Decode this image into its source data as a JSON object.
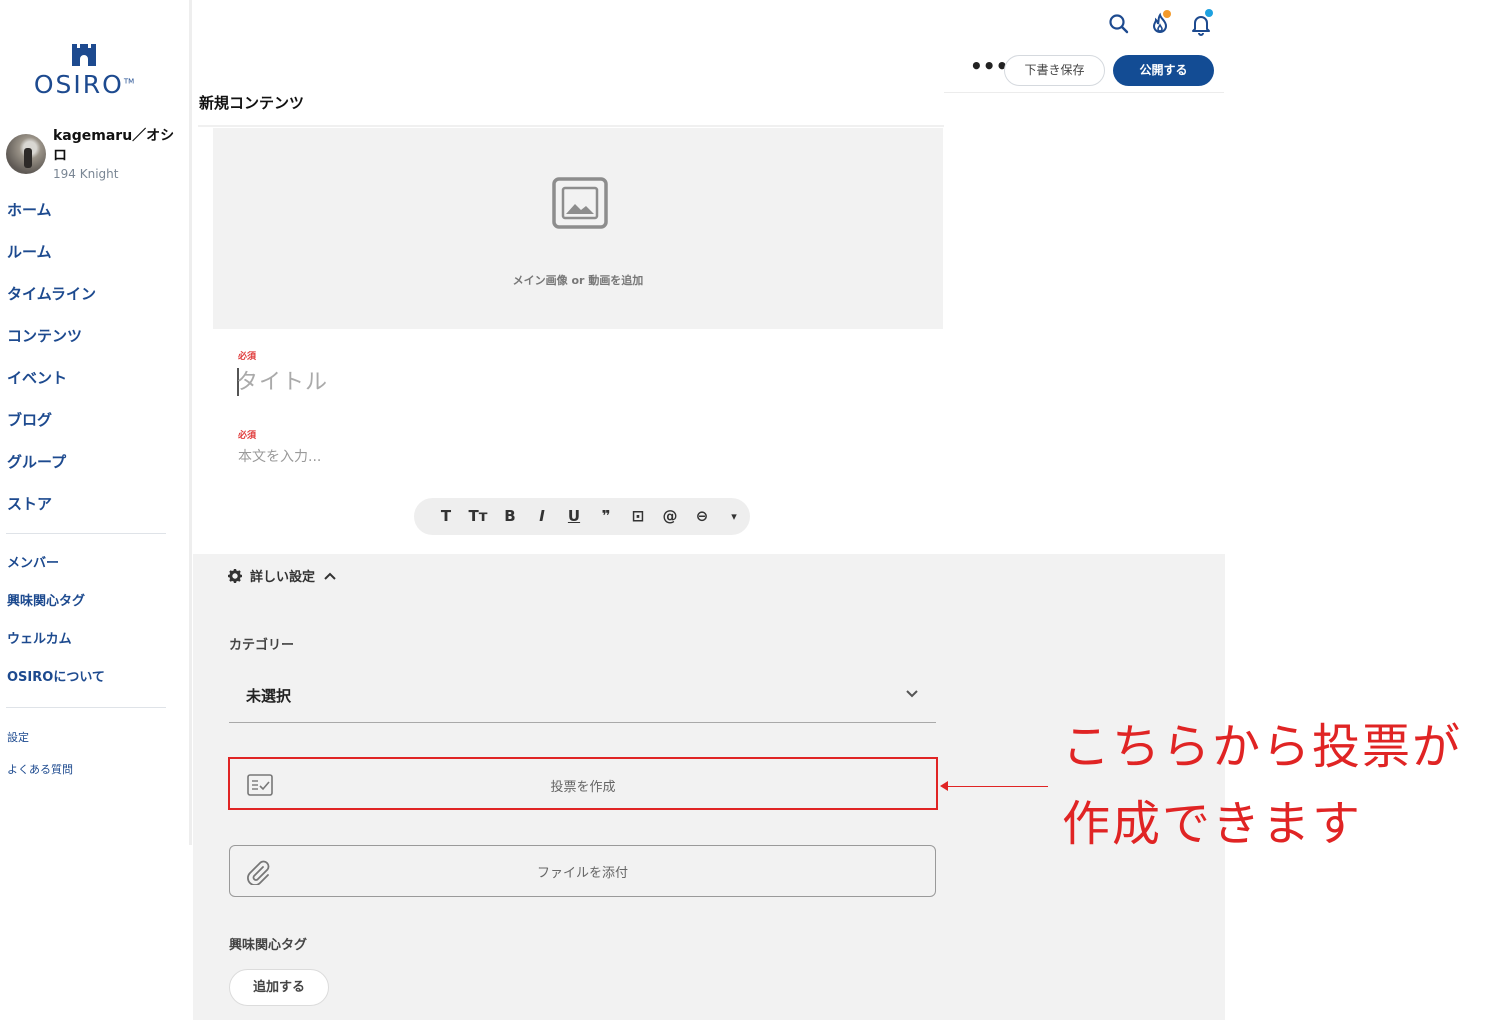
{
  "brand": {
    "name": "OSIRO",
    "tm": "TM"
  },
  "user": {
    "name": "kagemaru／オシロ",
    "points": "194 Knight"
  },
  "nav": {
    "items": [
      "ホーム",
      "ルーム",
      "タイムライン",
      "コンテンツ",
      "イベント",
      "ブログ",
      "グループ",
      "ストア"
    ]
  },
  "nav_secondary": {
    "items": [
      "メンバー",
      "興味関心タグ",
      "ウェルカム",
      "OSIROについて"
    ]
  },
  "nav_footer": {
    "items": [
      "設定",
      "よくある質問"
    ]
  },
  "header": {
    "more": "•••",
    "save_draft": "下書き保存",
    "publish": "公開する"
  },
  "page": {
    "title": "新規コンテンツ"
  },
  "media": {
    "label": "メイン画像 or 動画を追加"
  },
  "form": {
    "required_badge": "必須",
    "title_placeholder": "タイトル",
    "body_placeholder": "本文を入力..."
  },
  "toolbar": {
    "buttons": [
      "T",
      "Tт",
      "B",
      "I",
      "U",
      "❞",
      "⊡",
      "@",
      "⊖",
      "▾"
    ]
  },
  "settings": {
    "toggle_label": "詳しい設定",
    "category_label": "カテゴリー",
    "category_value": "未選択",
    "poll_button": "投票を作成",
    "file_button": "ファイルを添付",
    "tags_label": "興味関心タグ",
    "add_button": "追加する"
  },
  "annotation": {
    "line1": "こちらから投票が",
    "line2": "作成できます"
  },
  "colors": {
    "brand_blue": "#134c94",
    "accent_red": "#e02424",
    "badge_orange": "#f39a2b",
    "badge_blue": "#1ea1e0"
  },
  "icons": [
    "search-icon",
    "fire-icon",
    "bell-icon",
    "image-placeholder-icon",
    "gear-icon",
    "chevron-up-icon",
    "chevron-down-icon",
    "poll-icon",
    "paperclip-icon"
  ]
}
